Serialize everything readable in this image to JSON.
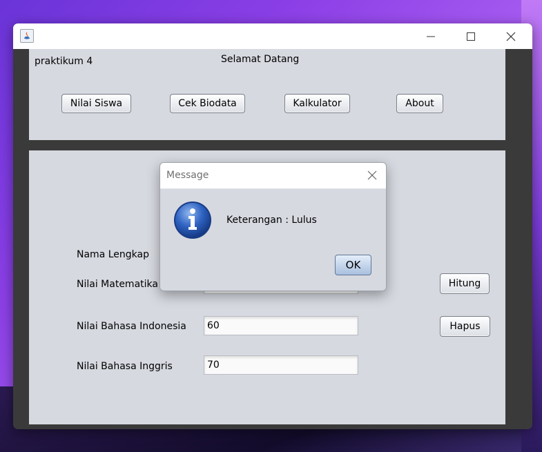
{
  "window": {
    "title": "",
    "controls": {
      "minimize_icon": "minimize-icon",
      "maximize_icon": "maximize-icon",
      "close_icon": "close-icon"
    }
  },
  "header": {
    "app_label": "praktikum 4",
    "welcome": "Selamat Datang",
    "nav_buttons": [
      "Nilai Siswa",
      "Cek Biodata",
      "Kalkulator",
      "About"
    ]
  },
  "form": {
    "fields": [
      {
        "label": "Nama Lengkap",
        "value": ""
      },
      {
        "label": "Nilai Matematika",
        "value": ""
      },
      {
        "label": "Nilai Bahasa Indonesia",
        "value": "60"
      },
      {
        "label": "Nilai Bahasa Inggris",
        "value": "70"
      }
    ],
    "hitung_label": "Hitung",
    "hapus_label": "Hapus"
  },
  "dialog": {
    "title": "Message",
    "message": "Keterangan : Lulus",
    "ok_label": "OK",
    "icon": "info-icon"
  },
  "colors": {
    "panel_bg": "#d6d9e0",
    "window_frame": "#3a3a3a",
    "ok_button": "#c3d4ea"
  }
}
